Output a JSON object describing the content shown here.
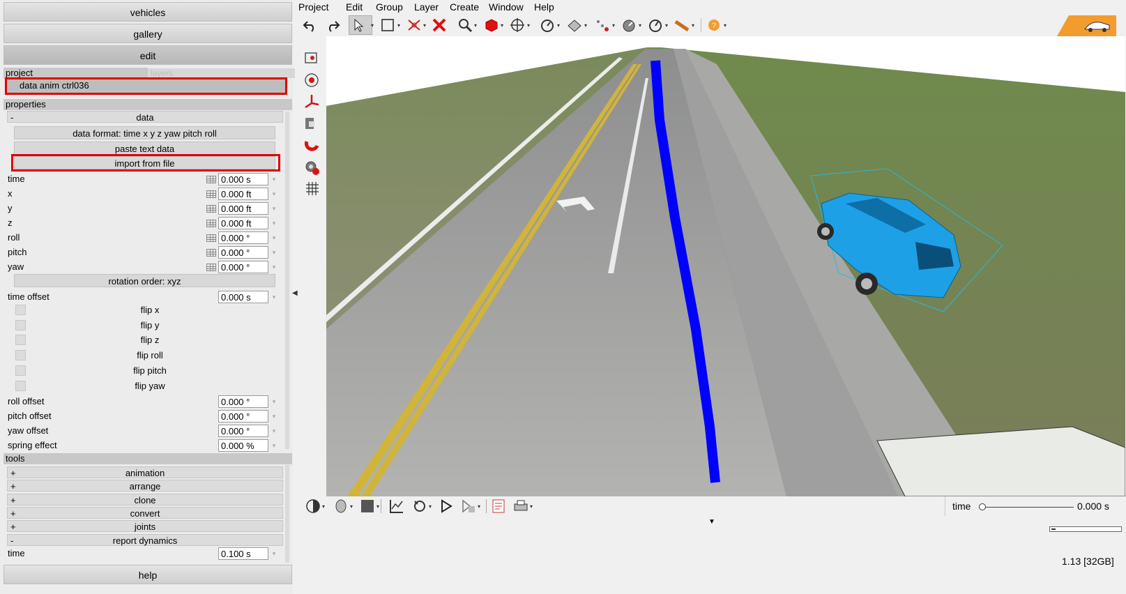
{
  "left_panel": {
    "nav": {
      "vehicles": "vehicles",
      "gallery": "gallery",
      "edit": "edit",
      "help": "help"
    },
    "tabs": {
      "project": "project",
      "layers": "layers"
    },
    "project_item": "data anim ctrl036",
    "properties_header": "properties",
    "data_section": "data",
    "buttons": {
      "data_format": "data format: time x y z yaw pitch roll",
      "paste": "paste text data",
      "import": "import from file",
      "rotation_order": "rotation order: xyz"
    },
    "fields": [
      {
        "label": "time",
        "value": "0.000 s"
      },
      {
        "label": "x",
        "value": "0.000 ft"
      },
      {
        "label": "y",
        "value": "0.000 ft"
      },
      {
        "label": "z",
        "value": "0.000 ft"
      },
      {
        "label": "roll",
        "value": "0.000 °"
      },
      {
        "label": "pitch",
        "value": "0.000 °"
      },
      {
        "label": "yaw",
        "value": "0.000 °"
      }
    ],
    "time_offset": {
      "label": "time offset",
      "value": "0.000 s"
    },
    "flips": [
      "flip x",
      "flip y",
      "flip z",
      "flip roll",
      "flip pitch",
      "flip yaw"
    ],
    "offsets": [
      {
        "label": "roll offset",
        "value": "0.000 °"
      },
      {
        "label": "pitch offset",
        "value": "0.000 °"
      },
      {
        "label": "yaw offset",
        "value": "0.000 °"
      },
      {
        "label": "spring effect",
        "value": "0.000 %"
      }
    ],
    "tools_header": "tools",
    "tools": [
      {
        "sign": "+",
        "label": "animation"
      },
      {
        "sign": "+",
        "label": "arrange"
      },
      {
        "sign": "+",
        "label": "clone"
      },
      {
        "sign": "+",
        "label": "convert"
      },
      {
        "sign": "+",
        "label": "joints"
      },
      {
        "sign": "-",
        "label": "report dynamics"
      }
    ],
    "report_time": {
      "label": "time",
      "value": "0.100 s"
    },
    "collapse_sign": "-"
  },
  "menubar": [
    "Project",
    "Edit",
    "Group",
    "Layer",
    "Create",
    "Window",
    "Help"
  ],
  "toolbar_icons": [
    "undo-icon",
    "redo-icon",
    "select-arrow-icon",
    "box-select-icon",
    "split-icon",
    "delete-icon",
    "zoom-icon",
    "cube-icon",
    "move-icon",
    "gauge-icon",
    "measure-icon",
    "trace-icon",
    "dial-icon",
    "dial2-icon",
    "tape-icon",
    "help-icon"
  ],
  "bottom": {
    "time_label": "time",
    "time_value": "0.000 s",
    "time_position": 0,
    "version": "1.13 [32GB]"
  },
  "colors": {
    "highlight": "#e00000",
    "vehicle": "#1ea0e6",
    "path": "#0000ff",
    "logo": "#f29c2f"
  }
}
